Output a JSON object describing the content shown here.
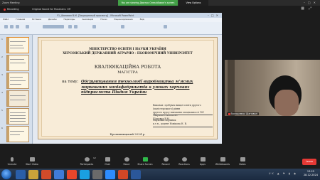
{
  "zoom_top": {
    "title": "Zoom Meeting",
    "banner": "You are viewing Дмитро Олексійович's screen",
    "view_options": "View Options"
  },
  "recording_bar": {
    "recording": "Recording",
    "original_sound": "Original Sound for Musicians: Off"
  },
  "ppt": {
    "window_title": "Y1_Шаповал В.М. [Защищенный просмотр] - Microsoft PowerPoint",
    "menu": [
      "Файл",
      "Главная",
      "Вставка",
      "Дизайн",
      "Переходы",
      "Анимация",
      "Показ",
      "Рецензирование",
      "Вид"
    ],
    "thumb_numbers": [
      "1",
      "2",
      "3",
      "4",
      "5",
      "6"
    ]
  },
  "slide": {
    "ministry": "МІНІСТЕРСТВО ОСВІТИ І НАУКИ УКРАЇНИ",
    "university": "ХЕРСОНСЬКИЙ ДЕРЖАВНИЙ АГРАРНО - ЕКОНОМІЧНИЙ УНІВЕРСИТЕТ",
    "work_type": "КВАЛІФІКАЦІЙНА РОБОТА",
    "degree": "МАГІСТРА",
    "topic_label": "на тему:",
    "topic": "Обґрунтування технології виробництва м'ясних мариованих напівфабрикатів в умовах харчових підприємств Півдня України",
    "author_1": "Виконав: здобувач вищої освіти другого (магістерського) рівня",
    "author_2": "другого курсу навчання спеціальності 181 «Харчові технології»",
    "author_3": "Шаповал В.М.",
    "supervisor_1": "Науковий керівник",
    "supervisor_2": "к.т.н., доцент Новікова Н. В.",
    "city": "Кропивницький 2024 р."
  },
  "cam": {
    "name": "Володимир Шаповал"
  },
  "zoom_bottom": {
    "unmute": "Unmute",
    "start_video": "Start Video",
    "participants": "Participants",
    "participants_count": "12",
    "chat": "Chat",
    "react": "React",
    "share_screen": "Share Screen",
    "record": "Record",
    "reactions": "Reactions",
    "apps": "Apps",
    "whiteboards": "Whiteboards",
    "notes": "Notes",
    "end": "Leave"
  },
  "taskbar": {
    "lang": "UK",
    "time": "13:25",
    "date": "28.12.2024"
  }
}
